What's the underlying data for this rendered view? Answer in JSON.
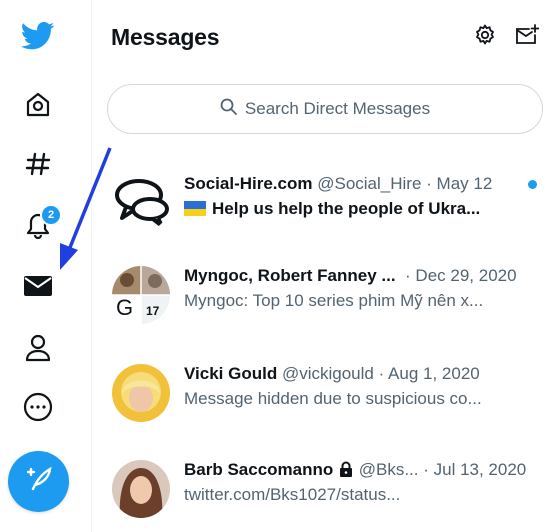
{
  "header": {
    "title": "Messages",
    "settings_icon": "gear-icon",
    "new_message_icon": "envelope-plus-icon"
  },
  "search": {
    "placeholder": "Search Direct Messages"
  },
  "nav": {
    "icons": [
      "twitter-bird-icon",
      "home-icon",
      "hashtag-icon",
      "bell-icon",
      "envelope-icon",
      "person-icon",
      "more-icon",
      "compose-icon"
    ],
    "notifications_badge": "2"
  },
  "colors": {
    "accent": "#1d9bf0",
    "text": "#0f1419",
    "muted": "#536471",
    "arrow": "#1f3fe0"
  },
  "conversations": [
    {
      "name": "Social-Hire.com",
      "handle": "@Social_Hire",
      "date": "· May 12",
      "preview": "Help us help the people of Ukra...",
      "unread": true
    },
    {
      "name": "Myngoc, Robert Fanney ...",
      "handle": "",
      "date": "· Dec 29, 2020",
      "preview": "Myngoc: Top 10 series phim Mỹ nên x...",
      "group_letter": "G",
      "group_count": "17"
    },
    {
      "name": "Vicki Gould",
      "handle": "@vickigould",
      "date": "· Aug 1, 2020",
      "preview": "Message hidden due to suspicious co..."
    },
    {
      "name": "Barb Saccomanno",
      "handle": "@Bks...",
      "date": "· Jul 13, 2020",
      "preview": "twitter.com/Bks1027/status..."
    }
  ]
}
